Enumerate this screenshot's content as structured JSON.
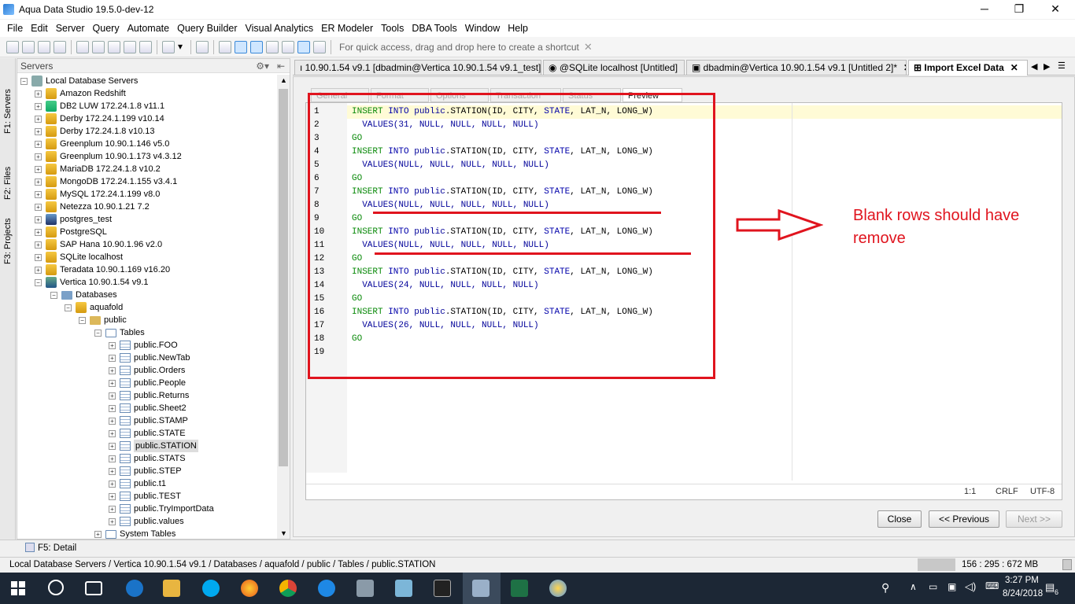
{
  "window": {
    "title": "Aqua Data Studio 19.5.0-dev-12",
    "minimize": "─",
    "maximize": "❐",
    "close": "✕"
  },
  "menu": [
    "File",
    "Edit",
    "Server",
    "Query",
    "Automate",
    "Query Builder",
    "Visual Analytics",
    "ER Modeler",
    "Tools",
    "DBA Tools",
    "Window",
    "Help"
  ],
  "toolbar": {
    "quick_access": "For quick access, drag and drop here to create a shortcut"
  },
  "left_strip": {
    "servers": "F1: Servers",
    "files": "F2: Files",
    "projects": "F3: Projects"
  },
  "servers_panel": {
    "title": "Servers",
    "root": "Local Database Servers",
    "servers": [
      "Amazon Redshift",
      "DB2 LUW 172.24.1.8 v11.1",
      "Derby 172.24.1.199 v10.14",
      "Derby 172.24.1.8 v10.13",
      "Greenplum 10.90.1.146 v5.0",
      "Greenplum 10.90.1.173 v4.3.12",
      "MariaDB 172.24.1.8 v10.2",
      "MongoDB 172.24.1.155 v3.4.1",
      "MySQL 172.24.1.199 v8.0",
      "Netezza 10.90.1.21 7.2",
      "postgres_test",
      "PostgreSQL",
      "SAP Hana 10.90.1.96 v2.0",
      "SQLite localhost",
      "Teradata 10.90.1.169 v16.20",
      "Vertica 10.90.1.54 v9.1"
    ],
    "databases": "Databases",
    "db": "aquafold",
    "schema": "public",
    "tables_folder": "Tables",
    "tables": [
      "public.FOO",
      "public.NewTab",
      "public.Orders",
      "public.People",
      "public.Returns",
      "public.Sheet2",
      "public.STAMP",
      "public.STATE",
      "public.STATION",
      "public.STATS",
      "public.STEP",
      "public.t1",
      "public.TEST",
      "public.TryImportData",
      "public.values"
    ],
    "system_tables": "System Tables"
  },
  "tabs": [
    {
      "label": "ı 10.90.1.54 v9.1 [dbadmin@Vertica 10.90.1.54 v9.1_test]"
    },
    {
      "label": "@SQLite localhost [Untitled]"
    },
    {
      "label": "dbadmin@Vertica 10.90.1.54 v9.1 [Untitled 2]*"
    },
    {
      "label": "Import Excel Data"
    }
  ],
  "tab_nav": {
    "left": "◀",
    "right": "▶",
    "menu": "☰"
  },
  "wizard_tabs": [
    "General",
    "Format",
    "Options",
    "Transaction",
    "Status",
    "Preview"
  ],
  "code_lines": [
    {
      "n": "1",
      "a": "INSERT",
      "b": " INTO ",
      "c": "public",
      "d": ".STATION(ID, CITY, ",
      "e": "STATE",
      "f": ", LAT_N, LONG_W)"
    },
    {
      "n": "2",
      "text": "  VALUES(31, NULL, NULL, NULL, NULL)"
    },
    {
      "n": "3",
      "text": "GO"
    },
    {
      "n": "4",
      "a": "INSERT",
      "b": " INTO ",
      "c": "public",
      "d": ".STATION(ID, CITY, ",
      "e": "STATE",
      "f": ", LAT_N, LONG_W)"
    },
    {
      "n": "5",
      "text": "  VALUES(NULL, NULL, NULL, NULL, NULL)"
    },
    {
      "n": "6",
      "text": "GO"
    },
    {
      "n": "7",
      "a": "INSERT",
      "b": " INTO ",
      "c": "public",
      "d": ".STATION(ID, CITY, ",
      "e": "STATE",
      "f": ", LAT_N, LONG_W)"
    },
    {
      "n": "8",
      "text": "  VALUES(NULL, NULL, NULL, NULL, NULL)"
    },
    {
      "n": "9",
      "text": "GO"
    },
    {
      "n": "10",
      "a": "INSERT",
      "b": " INTO ",
      "c": "public",
      "d": ".STATION(ID, CITY, ",
      "e": "STATE",
      "f": ", LAT_N, LONG_W)"
    },
    {
      "n": "11",
      "text": "  VALUES(NULL, NULL, NULL, NULL, NULL)"
    },
    {
      "n": "12",
      "text": "GO"
    },
    {
      "n": "13",
      "a": "INSERT",
      "b": " INTO ",
      "c": "public",
      "d": ".STATION(ID, CITY, ",
      "e": "STATE",
      "f": ", LAT_N, LONG_W)"
    },
    {
      "n": "14",
      "text": "  VALUES(24, NULL, NULL, NULL, NULL)"
    },
    {
      "n": "15",
      "text": "GO"
    },
    {
      "n": "16",
      "a": "INSERT",
      "b": " INTO ",
      "c": "public",
      "d": ".STATION(ID, CITY, ",
      "e": "STATE",
      "f": ", LAT_N, LONG_W)"
    },
    {
      "n": "17",
      "text": "  VALUES(26, NULL, NULL, NULL, NULL)"
    },
    {
      "n": "18",
      "text": "GO"
    },
    {
      "n": "19",
      "text": ""
    }
  ],
  "editor_status": {
    "position": "1:1",
    "line_ending": "CRLF",
    "encoding": "UTF-8"
  },
  "buttons": {
    "close": "Close",
    "previous": "<< Previous",
    "next": "Next >>"
  },
  "annotation": {
    "note": "Blank rows should have remove",
    "color": "#e0141e"
  },
  "detail_bar": {
    "label": "F5: Detail"
  },
  "statusbar": {
    "path": "Local Database Servers / Vertica 10.90.1.54 v9.1 / Databases / aquafold / public / Tables / public.STATION",
    "memory": "156 : 295 : 672 MB"
  },
  "taskbar": {
    "time": "3:27 PM",
    "date": "8/24/2018",
    "notification_count": "6"
  }
}
